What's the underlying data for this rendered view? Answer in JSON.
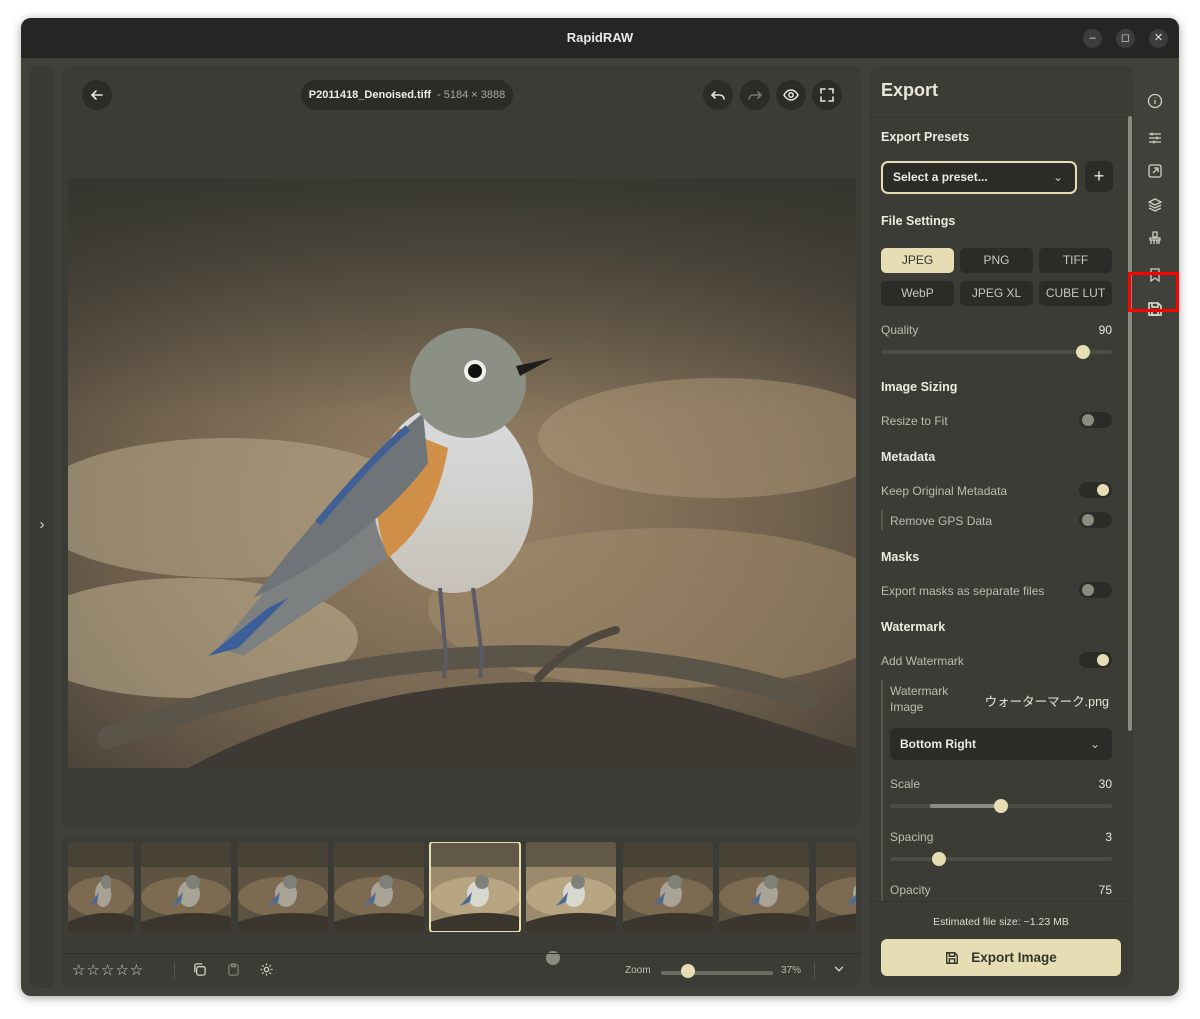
{
  "window": {
    "title": "RapidRAW"
  },
  "titlebar": {
    "minimize": "–",
    "maximize": "◻",
    "close": "✕"
  },
  "left_panel": {
    "expand_glyph": "›"
  },
  "editor": {
    "file_name": "P2011418_Denoised.tiff",
    "dimensions": "- 5184 × 3888",
    "icons": [
      "back-arrow-icon",
      "undo-icon",
      "redo-icon",
      "eye-icon",
      "fullscreen-icon"
    ]
  },
  "filmstrip": {
    "thumbnail_count": 9,
    "selected_index": 4
  },
  "bottom_bar": {
    "rating_stars": "☆☆☆☆☆",
    "zoom_label": "Zoom",
    "zoom_value": "37%",
    "zoom_level": 0.2,
    "icons": [
      "copy-icon",
      "paste-icon",
      "settings-icon",
      "chevron-down-icon"
    ]
  },
  "export_panel": {
    "title": "Export",
    "presets": {
      "heading": "Export Presets",
      "placeholder": "Select a preset...",
      "add_label": "+"
    },
    "file_settings": {
      "heading": "File Settings",
      "formats": [
        "JPEG",
        "PNG",
        "TIFF",
        "WebP",
        "JPEG XL",
        "CUBE LUT"
      ],
      "selected_format": "JPEG",
      "quality_label": "Quality",
      "quality_value": "90",
      "quality_fraction": 0.9
    },
    "image_sizing": {
      "heading": "Image Sizing",
      "resize_label": "Resize to Fit",
      "resize_on": false
    },
    "metadata": {
      "heading": "Metadata",
      "keep_label": "Keep Original Metadata",
      "keep_on": true,
      "gps_label": "Remove GPS Data",
      "gps_on": false
    },
    "masks": {
      "heading": "Masks",
      "separate_label": "Export masks as separate files",
      "separate_on": false
    },
    "watermark": {
      "heading": "Watermark",
      "add_label": "Add Watermark",
      "add_on": true,
      "image_label_1": "Watermark",
      "image_label_2": "Image",
      "image_file": "ウォーターマーク.png",
      "position": "Bottom Right",
      "scale_label": "Scale",
      "scale_value": "30",
      "scale_fraction": 0.5,
      "spacing_label": "Spacing",
      "spacing_value": "3",
      "spacing_fraction": 0.2,
      "opacity_label": "Opacity",
      "opacity_value": "75"
    },
    "estimated_size": "Estimated file size: ~1.23 MB",
    "export_button": "Export Image"
  },
  "right_rail": {
    "icons": [
      "info-icon",
      "adjustments-icon",
      "crop-icon",
      "layers-icon",
      "brush-icon",
      "bookmark-icon",
      "save-icon"
    ],
    "active": "save-icon"
  },
  "colors": {
    "accent": "#e6ddb4",
    "panel_bg": "#3b3c35",
    "app_bg": "#40413a",
    "highlight": "#ff0000"
  }
}
